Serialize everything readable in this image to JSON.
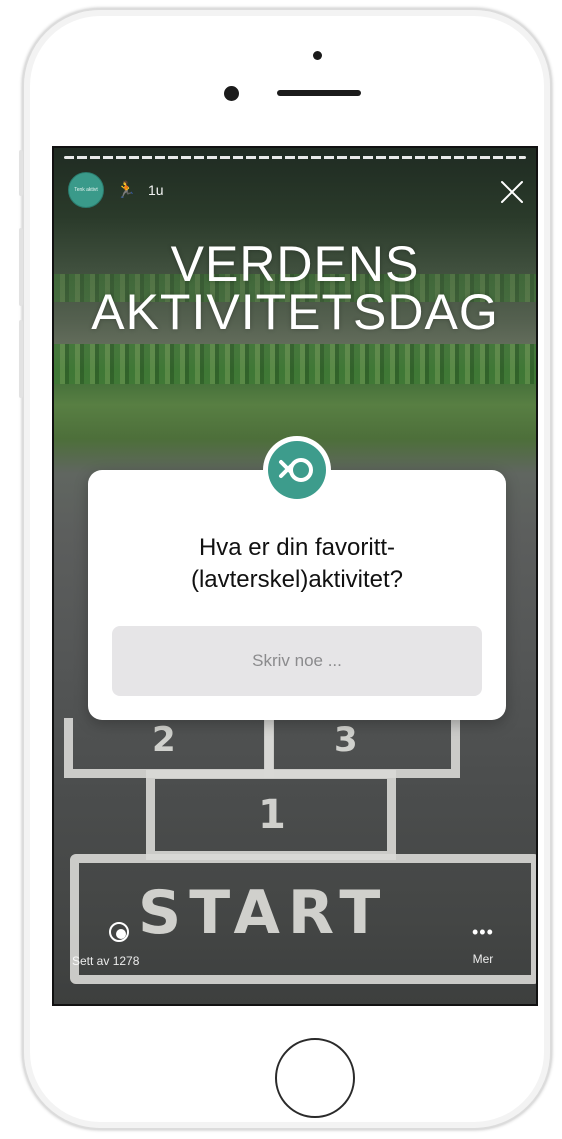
{
  "story": {
    "account_avatar_text": "Tenk aktivt",
    "time_ago": "1u",
    "headline_line1": "VERDENS",
    "headline_line2": "AKTIVITETSDAG",
    "question": "Hva er din favoritt-(lavterskel)aktivitet?",
    "input_placeholder": "Skriv noe ...",
    "seen_by": "Sett av 1278",
    "more_label": "Mer",
    "background_chalk": {
      "square_2a": "2",
      "square_2b": "3",
      "square_1": "1",
      "start": "START"
    }
  },
  "icons": {
    "runner": "runner-emoji-icon",
    "close": "close-icon",
    "eye": "eye-icon",
    "more": "more-dots-icon",
    "question_logo": "logo-icon"
  },
  "colors": {
    "accent_teal": "#3d9c8c",
    "card_background": "#ffffff",
    "input_background": "#e6e5e7"
  }
}
